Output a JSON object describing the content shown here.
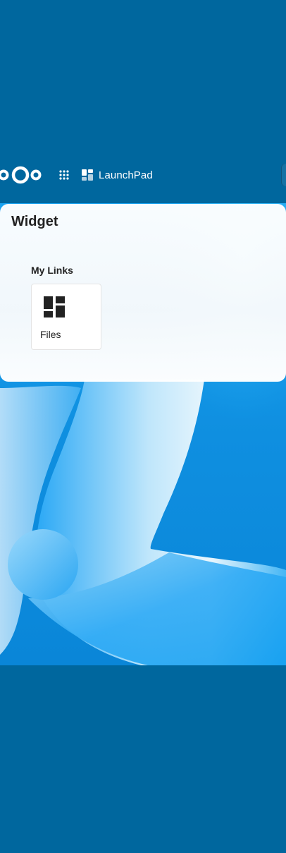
{
  "header": {
    "logo_icon": "nextcloud-logo-icon",
    "apps_menu_icon": "apps-grid-icon",
    "active_app": {
      "icon": "dashboard-icon",
      "label": "LaunchPad"
    }
  },
  "widget": {
    "title": "Widget",
    "sections": [
      {
        "title": "My Links",
        "links": [
          {
            "label": "Files",
            "icon": "dashboard-icon"
          }
        ]
      }
    ]
  },
  "colors": {
    "page_background": "#00679e",
    "card_background": "#ffffff",
    "text": "#222222",
    "header_text": "#ffffff"
  }
}
